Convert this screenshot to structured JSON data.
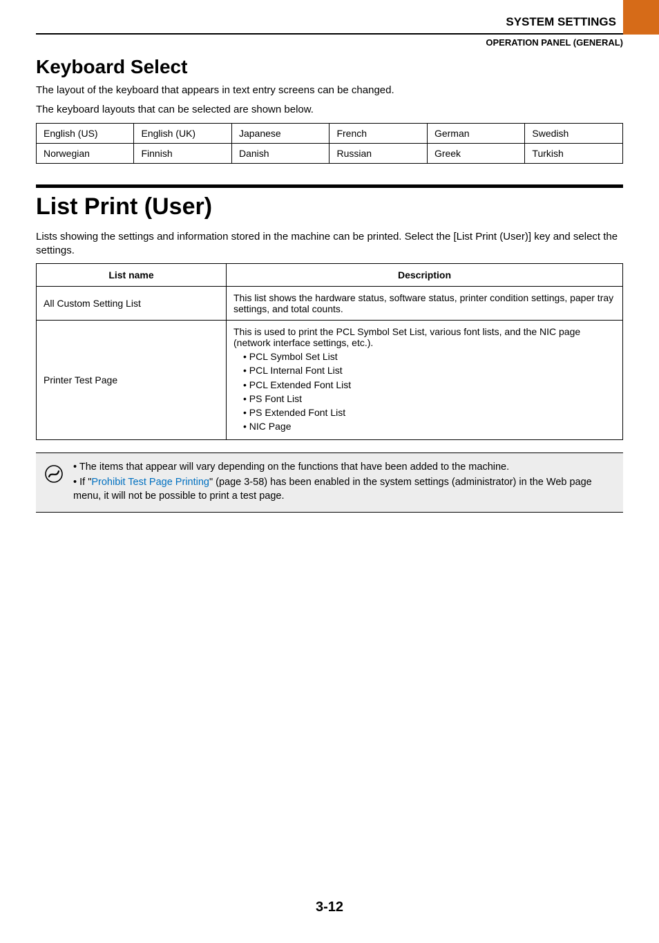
{
  "header": {
    "section_title": "SYSTEM SETTINGS",
    "subsection": "OPERATION PANEL (GENERAL)"
  },
  "keyboard": {
    "heading": "Keyboard Select",
    "para1": "The layout of the keyboard that appears in text entry screens can be changed.",
    "para2": "The keyboard layouts that can be selected are shown below.",
    "row1": [
      "English (US)",
      "English (UK)",
      "Japanese",
      "French",
      "German",
      "Swedish"
    ],
    "row2": [
      "Norwegian",
      "Finnish",
      "Danish",
      "Russian",
      "Greek",
      "Turkish"
    ]
  },
  "listprint": {
    "heading": "List Print (User)",
    "intro": "Lists showing the settings and information stored in the machine can be printed. Select the [List Print (User)] key and select the settings.",
    "col_name": "List name",
    "col_desc": "Description",
    "rows": [
      {
        "name": "All Custom Setting List",
        "desc": "This list shows the hardware status, software status, printer condition settings, paper tray settings, and total counts."
      },
      {
        "name": "Printer Test Page",
        "desc_intro": "This is used to print the PCL Symbol Set List, various font lists, and the NIC page (network interface settings, etc.).",
        "bullets": [
          "PCL Symbol Set List",
          "PCL Internal Font List",
          "PCL Extended Font List",
          "PS Font List",
          "PS Extended Font List",
          "NIC Page"
        ]
      }
    ]
  },
  "note": {
    "line1": "The items that appear will vary depending on the functions that have been added to the machine.",
    "line2_pre": "If \"",
    "line2_link": "Prohibit Test Page Printing",
    "line2_post": "\" (page 3-58) has been enabled in the system settings (administrator) in the Web page menu, it will not be possible to print a test page."
  },
  "page_number": "3-12"
}
